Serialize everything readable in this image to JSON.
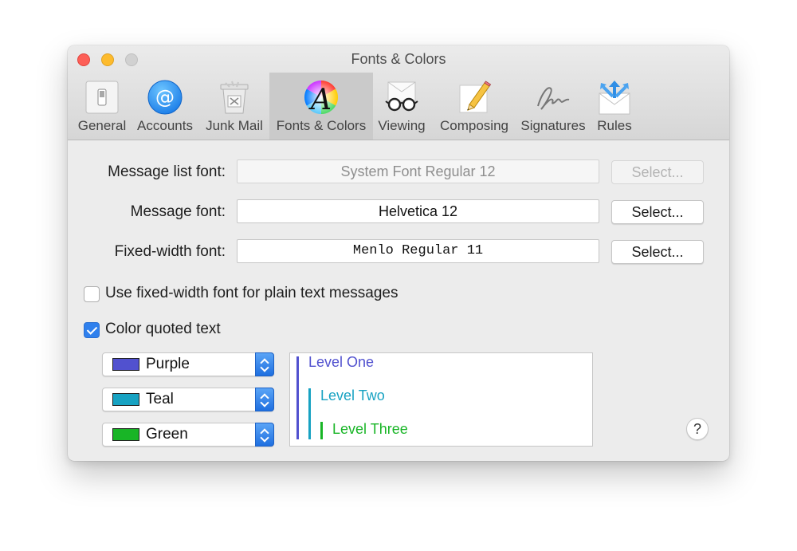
{
  "window": {
    "title": "Fonts & Colors"
  },
  "toolbar": {
    "tabs": [
      {
        "label": "General",
        "icon": "switch-icon"
      },
      {
        "label": "Accounts",
        "icon": "at-sign-icon"
      },
      {
        "label": "Junk Mail",
        "icon": "trash-can-icon"
      },
      {
        "label": "Fonts & Colors",
        "icon": "font-color-wheel-icon",
        "active": true
      },
      {
        "label": "Viewing",
        "icon": "glasses-icon"
      },
      {
        "label": "Composing",
        "icon": "pencil-paper-icon"
      },
      {
        "label": "Signatures",
        "icon": "signature-icon"
      },
      {
        "label": "Rules",
        "icon": "envelope-arrows-icon"
      }
    ]
  },
  "fonts": {
    "message_list": {
      "label": "Message list font:",
      "value": "System Font Regular 12",
      "button": "Select...",
      "enabled": false
    },
    "message": {
      "label": "Message font:",
      "value": "Helvetica 12",
      "button": "Select...",
      "enabled": true
    },
    "fixed_width": {
      "label": "Fixed-width font:",
      "value": "Menlo Regular 11",
      "button": "Select...",
      "enabled": true
    }
  },
  "options": {
    "use_fixed_width": {
      "label": "Use fixed-width font for plain text messages",
      "checked": false
    },
    "color_quoted": {
      "label": "Color quoted text",
      "checked": true
    }
  },
  "quote_colors": [
    {
      "name": "Purple",
      "color": "#5151cf"
    },
    {
      "name": "Teal",
      "color": "#17a2c2"
    },
    {
      "name": "Green",
      "color": "#18b526"
    }
  ],
  "preview": {
    "level_one": "Level One",
    "level_two": "Level Two",
    "level_three": "Level Three"
  },
  "help": {
    "label": "?"
  }
}
